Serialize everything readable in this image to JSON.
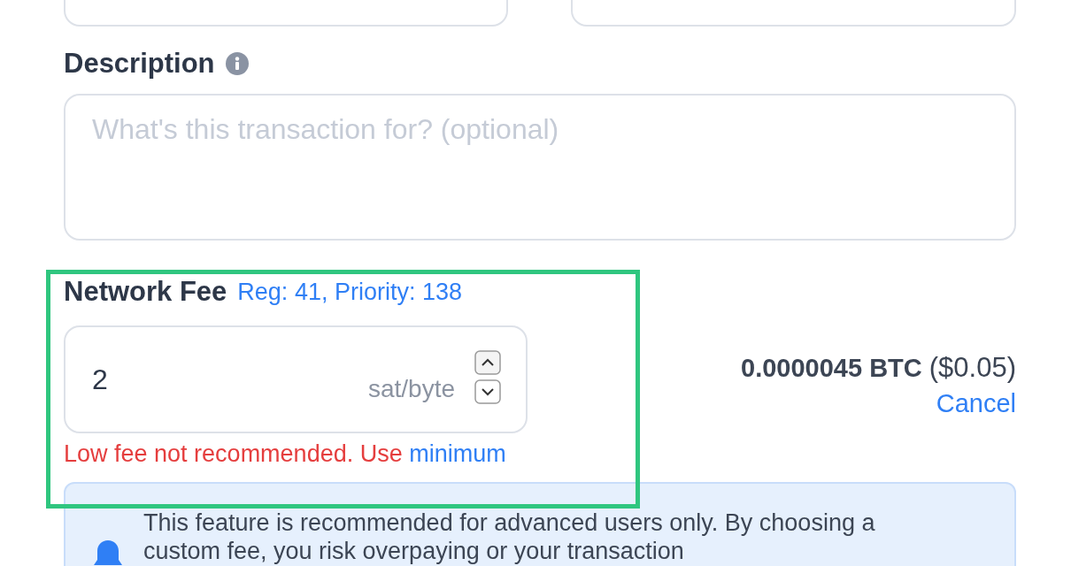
{
  "top_fields": [
    {
      "kind": "text"
    },
    {
      "kind": "text"
    }
  ],
  "description": {
    "label": "Description",
    "placeholder": "What's this transaction for? (optional)"
  },
  "network_fee": {
    "label": "Network Fee",
    "hint": "Reg: 41, Priority: 138",
    "value": "2",
    "unit": "sat/byte",
    "warning": "Low fee not recommended. Use",
    "warning_link": "minimum",
    "highlighted": true
  },
  "fee_total": {
    "amount": "0.0000045 BTC",
    "fiat": "($0.05)",
    "cancel": "Cancel"
  },
  "notice": {
    "text": "This feature is recommended for advanced users only. By choosing a custom fee, you risk overpaying or your transaction"
  }
}
